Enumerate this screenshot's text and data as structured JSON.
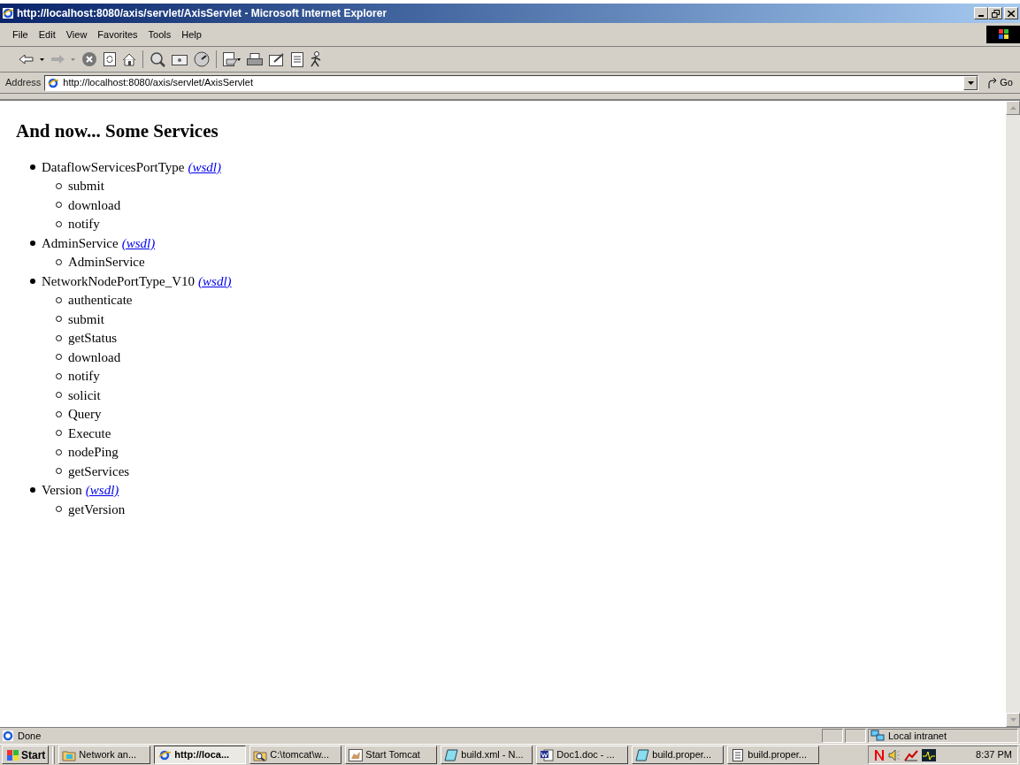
{
  "window": {
    "title": "http://localhost:8080/axis/servlet/AxisServlet - Microsoft Internet Explorer"
  },
  "menu": [
    "File",
    "Edit",
    "View",
    "Favorites",
    "Tools",
    "Help"
  ],
  "address": {
    "label": "Address",
    "value": "http://localhost:8080/axis/servlet/AxisServlet",
    "go": "Go"
  },
  "page": {
    "heading": "And now... Some Services",
    "services": [
      {
        "name": "DataflowServicesPortType",
        "link": "(wsdl)",
        "operations": [
          "submit",
          "download",
          "notify"
        ]
      },
      {
        "name": "AdminService",
        "link": "(wsdl)",
        "operations": [
          "AdminService"
        ]
      },
      {
        "name": "NetworkNodePortType_V10",
        "link": "(wsdl)",
        "operations": [
          "authenticate",
          "submit",
          "getStatus",
          "download",
          "notify",
          "solicit",
          "Query",
          "Execute",
          "nodePing",
          "getServices"
        ]
      },
      {
        "name": "Version",
        "link": "(wsdl)",
        "operations": [
          "getVersion"
        ]
      }
    ]
  },
  "status_bar": {
    "text": "Done",
    "zone": "Local intranet"
  },
  "taskbar": {
    "start": "Start",
    "clock": "8:37 PM",
    "buttons": [
      {
        "label": "Network an...",
        "kind": "folder",
        "selected": false
      },
      {
        "label": "http://loca...",
        "kind": "ie",
        "selected": true
      },
      {
        "label": "C:\\tomcat\\w...",
        "kind": "search",
        "selected": false
      },
      {
        "label": "Start Tomcat",
        "kind": "cat",
        "selected": false
      },
      {
        "label": "build.xml - N...",
        "kind": "book",
        "selected": false
      },
      {
        "label": "Doc1.doc - ...",
        "kind": "word",
        "selected": false
      },
      {
        "label": "build.proper...",
        "kind": "book",
        "selected": false
      },
      {
        "label": "build.proper...",
        "kind": "notepad",
        "selected": false
      }
    ]
  }
}
